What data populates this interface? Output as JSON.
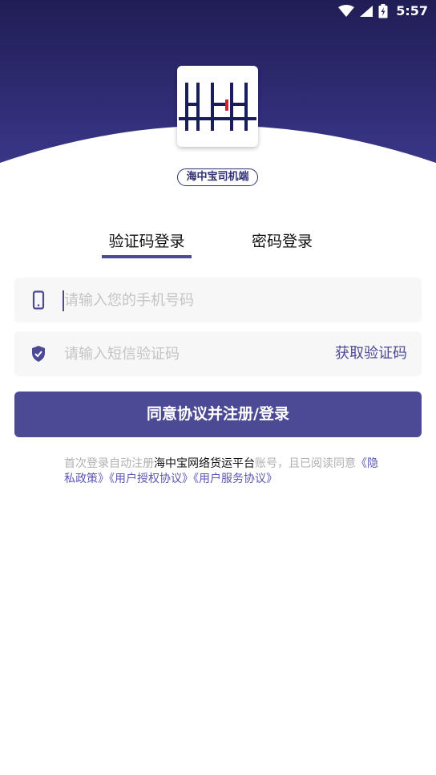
{
  "status_bar": {
    "time": "5:57"
  },
  "logo": {
    "alt": "HH logo"
  },
  "app_badge": "海中宝司机端",
  "tabs": [
    {
      "label": "验证码登录",
      "active": true
    },
    {
      "label": "密码登录",
      "active": false
    }
  ],
  "phone_field": {
    "placeholder": "请输入您的手机号码",
    "value": ""
  },
  "code_field": {
    "placeholder": "请输入短信验证码",
    "value": ""
  },
  "get_code_label": "获取验证码",
  "submit_label": "同意协议并注册/登录",
  "agreement": {
    "prefix": "首次登录自动注册",
    "platform": "海中宝网络货运平台",
    "middle": "账号，且已阅读同意",
    "privacy": "《隐私政策》",
    "authorization": "《用户授权协议》",
    "service": "《用户服务协议》"
  },
  "colors": {
    "header_top": "#1f1c52",
    "header_bottom": "#4d4a95",
    "accent": "#4d4a95",
    "link": "#5a57b0",
    "placeholder": "#c4c4c4",
    "input_bg": "#f7f7f8"
  }
}
